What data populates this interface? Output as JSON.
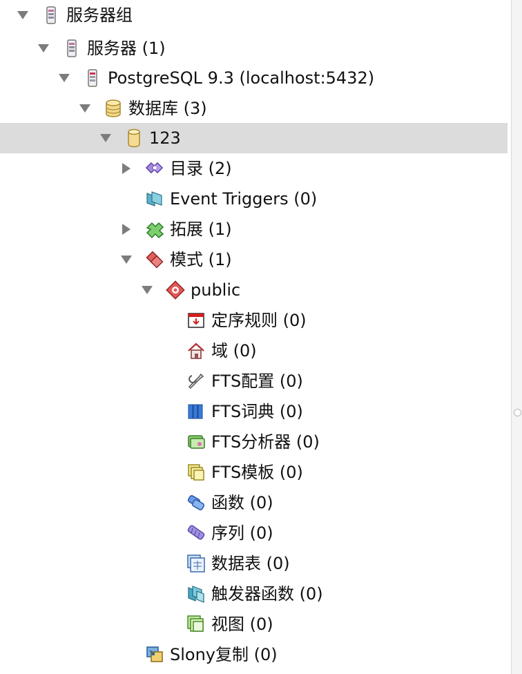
{
  "tree": {
    "items": [
      {
        "label": "服务器组",
        "icon": "server-group-icon",
        "toggle": "expanded"
      },
      {
        "label": "服务器 (1)",
        "icon": "server-icon",
        "toggle": "expanded"
      },
      {
        "label": "PostgreSQL 9.3 (localhost:5432)",
        "icon": "postgresql-server-icon",
        "toggle": "expanded"
      },
      {
        "label": "数据库 (3)",
        "icon": "databases-icon",
        "toggle": "expanded"
      },
      {
        "label": "123",
        "icon": "database-icon",
        "toggle": "expanded",
        "selected": true
      },
      {
        "label": "目录 (2)",
        "icon": "catalogs-icon",
        "toggle": "collapsed"
      },
      {
        "label": "Event Triggers (0)",
        "icon": "event-triggers-icon",
        "toggle": "none"
      },
      {
        "label": "拓展 (1)",
        "icon": "extensions-icon",
        "toggle": "collapsed"
      },
      {
        "label": "模式 (1)",
        "icon": "schemas-icon",
        "toggle": "expanded"
      },
      {
        "label": "public",
        "icon": "schema-icon",
        "toggle": "expanded"
      },
      {
        "label": "定序规则 (0)",
        "icon": "collations-icon",
        "toggle": "none"
      },
      {
        "label": "域 (0)",
        "icon": "domains-icon",
        "toggle": "none"
      },
      {
        "label": "FTS配置 (0)",
        "icon": "fts-configurations-icon",
        "toggle": "none"
      },
      {
        "label": "FTS词典 (0)",
        "icon": "fts-dictionaries-icon",
        "toggle": "none"
      },
      {
        "label": "FTS分析器 (0)",
        "icon": "fts-parsers-icon",
        "toggle": "none"
      },
      {
        "label": "FTS模板 (0)",
        "icon": "fts-templates-icon",
        "toggle": "none"
      },
      {
        "label": "函数 (0)",
        "icon": "functions-icon",
        "toggle": "none"
      },
      {
        "label": "序列 (0)",
        "icon": "sequences-icon",
        "toggle": "none"
      },
      {
        "label": "数据表 (0)",
        "icon": "tables-icon",
        "toggle": "none"
      },
      {
        "label": "触发器函数 (0)",
        "icon": "trigger-functions-icon",
        "toggle": "none"
      },
      {
        "label": "视图 (0)",
        "icon": "views-icon",
        "toggle": "none"
      },
      {
        "label": "Slony复制 (0)",
        "icon": "slony-replication-icon",
        "toggle": "none"
      }
    ]
  },
  "colors": {
    "selection": "#dcdcdc",
    "toggle": "#7c7c7c"
  }
}
